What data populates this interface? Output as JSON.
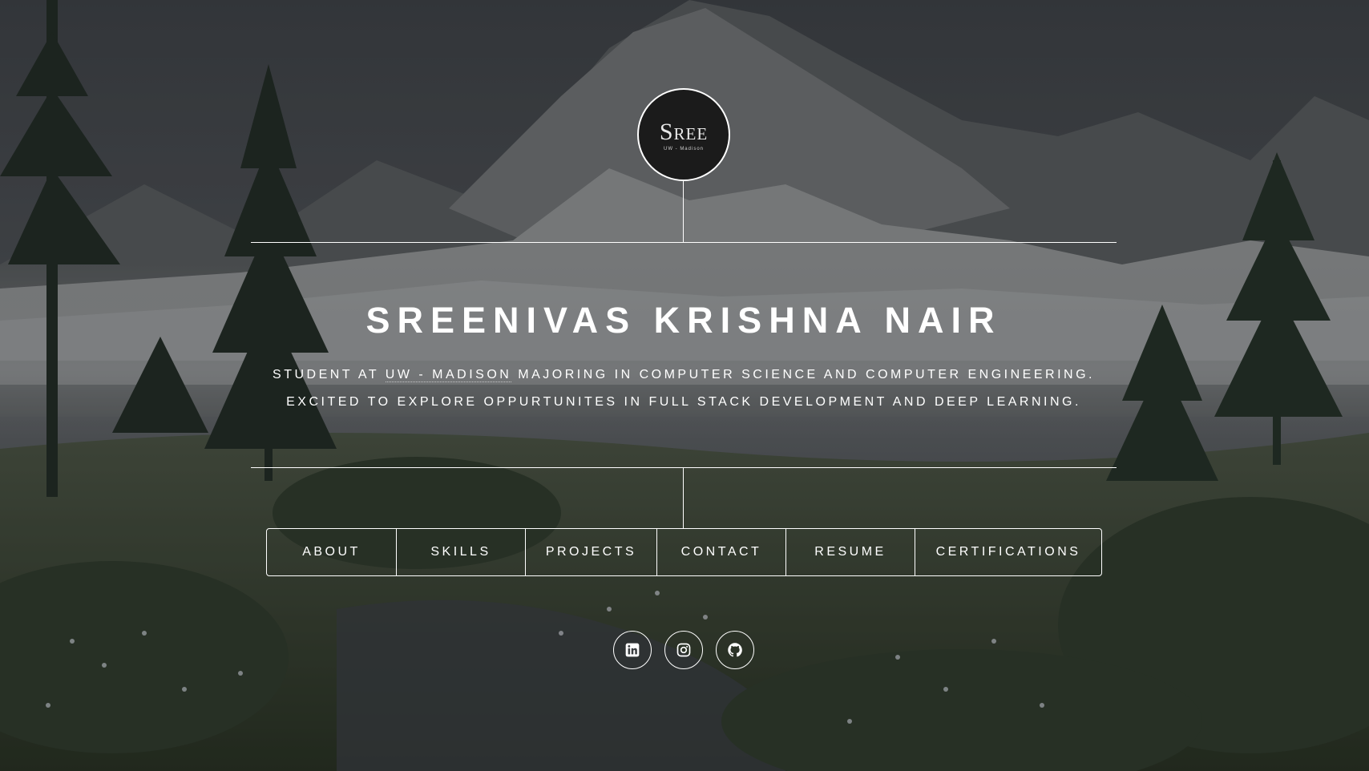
{
  "logo": {
    "text": "Sree",
    "subtext": "UW - Madison"
  },
  "intro": {
    "name": "SREENIVAS KRISHNA NAIR",
    "line1_prefix": "STUDENT AT ",
    "line1_link": "UW - MADISON",
    "line1_suffix": " MAJORING IN COMPUTER SCIENCE AND COMPUTER ENGINEERING.",
    "line2": "EXCITED TO EXPLORE OPPURTUNITES IN FULL STACK DEVELOPMENT AND DEEP LEARNING."
  },
  "nav": {
    "items": [
      {
        "label": "ABOUT"
      },
      {
        "label": "SKILLS"
      },
      {
        "label": "PROJECTS"
      },
      {
        "label": "CONTACT"
      },
      {
        "label": "RESUME"
      },
      {
        "label": "CERTIFICATIONS"
      }
    ]
  },
  "socials": [
    {
      "icon": "linkedin-icon"
    },
    {
      "icon": "instagram-icon"
    },
    {
      "icon": "github-icon"
    }
  ],
  "colors": {
    "foreground": "#ffffff",
    "logo_background": "#1b1b1b"
  }
}
